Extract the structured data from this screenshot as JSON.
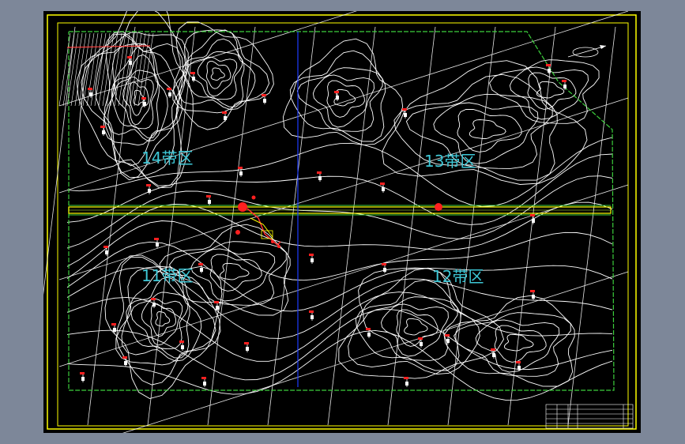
{
  "zones": [
    {
      "id": "zone-14",
      "label": "14带区"
    },
    {
      "id": "zone-13",
      "label": "13带区"
    },
    {
      "id": "zone-11",
      "label": "11带区"
    },
    {
      "id": "zone-12",
      "label": "12带区"
    }
  ],
  "colors": {
    "background": "#000000",
    "frame": "#ffff00",
    "contour": "#ffffff",
    "boundary": "#3ccf3c",
    "divider": "#1e3cff",
    "road": "#ffff00",
    "zone_label": "#3ec7d6",
    "well_marker": "#ff2020",
    "screen_bg": "#7d8799"
  },
  "icons": {
    "north_arrow": "north-arrow-icon",
    "well": "borehole-marker-icon"
  },
  "title_block": {
    "rows": 5
  }
}
